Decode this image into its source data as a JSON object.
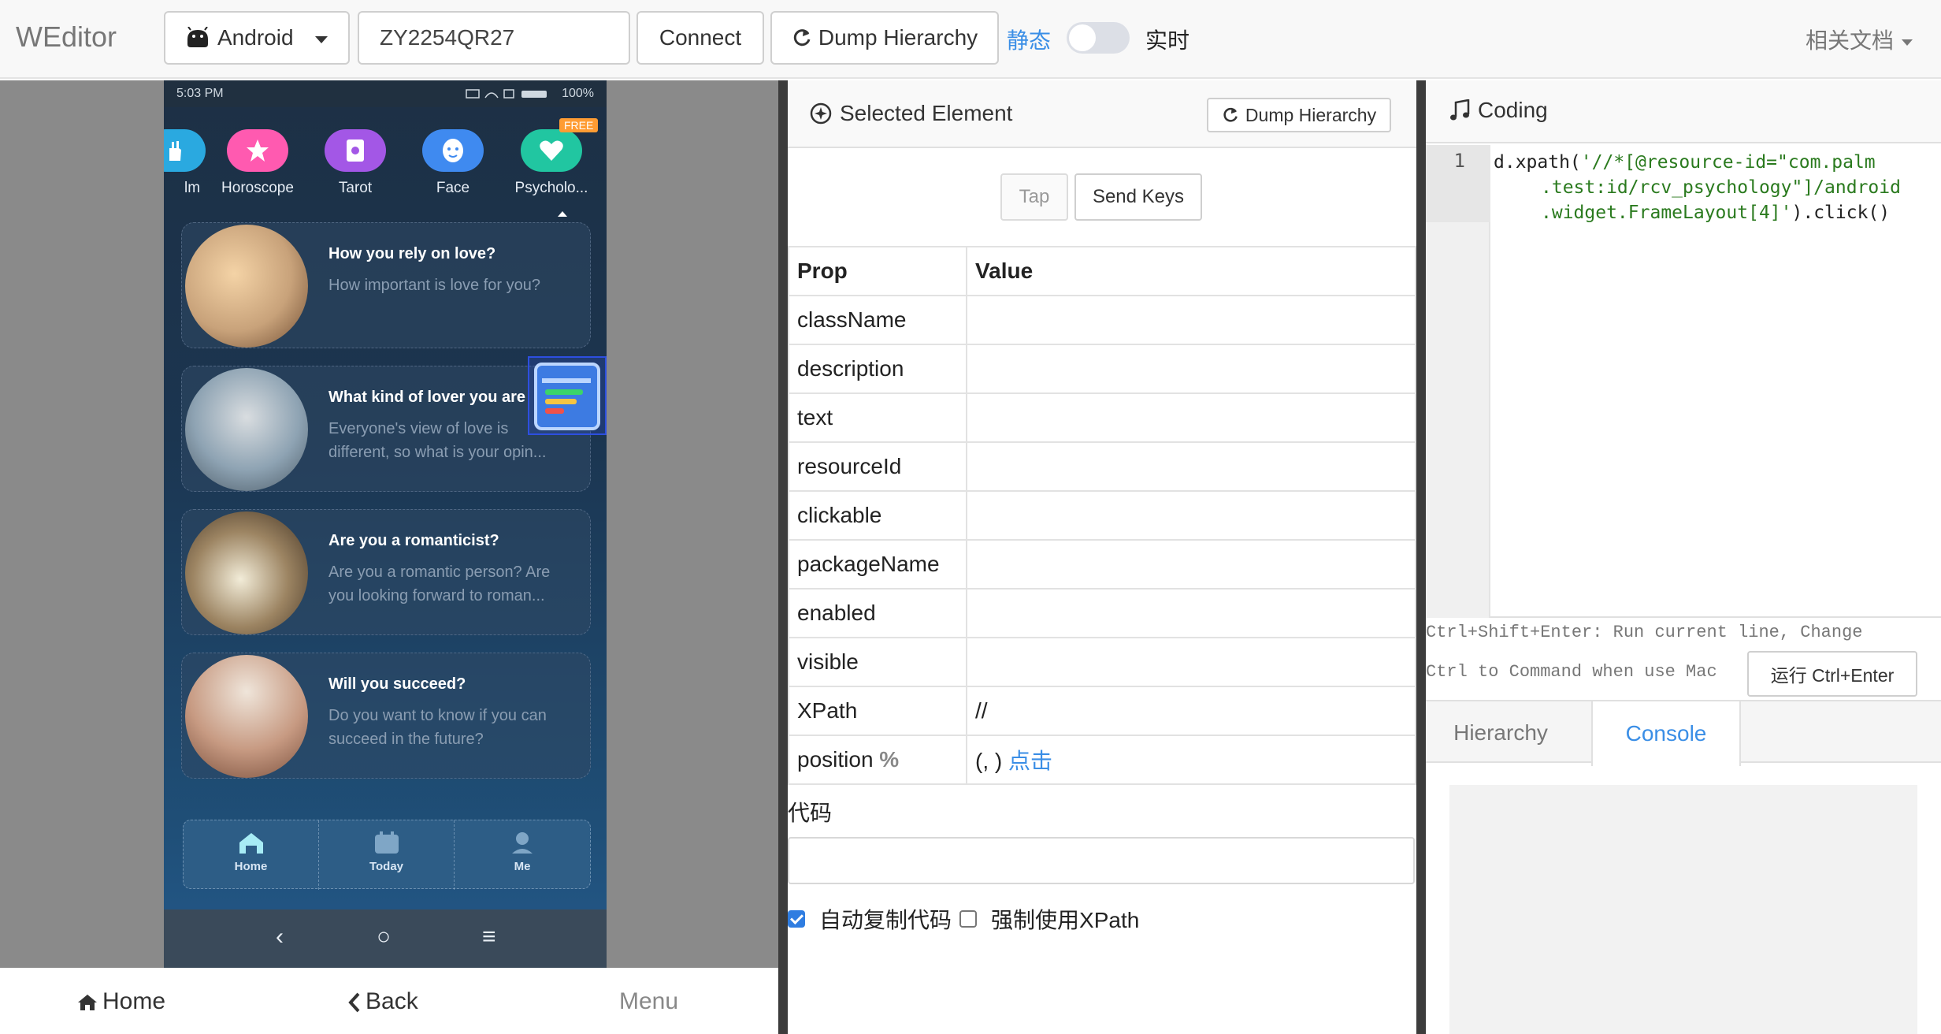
{
  "navbar": {
    "brand": "WEditor",
    "platform": "Android",
    "serial": "ZY2254QR27",
    "connect": "Connect",
    "dump": "Dump Hierarchy",
    "mode_static": "静态",
    "mode_live": "实时",
    "docs": "相关文档"
  },
  "device": {
    "status": {
      "time": "5:03 PM",
      "battery": "100%"
    },
    "categories": [
      {
        "label": "lm",
        "color": "#2aa9e0"
      },
      {
        "label": "Horoscope",
        "color": "#ff5ab0"
      },
      {
        "label": "Tarot",
        "color": "#a357e6"
      },
      {
        "label": "Face",
        "color": "#3f8af0"
      },
      {
        "label": "Psycholo...",
        "color": "#21c6a1"
      }
    ],
    "free_badge": "FREE",
    "cards": [
      {
        "title": "How you rely on love?",
        "desc": "How important is love for you?",
        "color": "#c8a27a"
      },
      {
        "title": "What kind of lover you are",
        "desc": "Everyone's view of love is different, so what is your opin...",
        "color": "#8ea3b3"
      },
      {
        "title": "Are you a romanticist?",
        "desc": "Are you a romantic person? Are you looking forward to roman...",
        "color": "#9c8462"
      },
      {
        "title": "Will you succeed?",
        "desc": "Do you want to know if you can succeed in the future?",
        "color": "#c79a82"
      }
    ],
    "tabs": [
      {
        "label": "Home"
      },
      {
        "label": "Today"
      },
      {
        "label": "Me"
      }
    ],
    "sysnav": {
      "back": "‹",
      "home": "○",
      "menu": "≡"
    }
  },
  "bottom_nav": {
    "home": "Home",
    "back": "Back",
    "menu": "Menu"
  },
  "selected": {
    "title": "Selected Element",
    "dump": "Dump Hierarchy",
    "tap": "Tap",
    "send_keys": "Send Keys",
    "col_prop": "Prop",
    "col_value": "Value",
    "props": {
      "className": "className",
      "description": "description",
      "text": "text",
      "resourceId": "resourceId",
      "clickable": "clickable",
      "packageName": "packageName",
      "enabled": "enabled",
      "visible": "visible",
      "xpath": "XPath",
      "xpath_value": "//",
      "position": "position",
      "position_unit": "%",
      "position_value": "(, )",
      "position_click": "点击"
    },
    "code_label": "代码",
    "auto_copy": "自动复制代码",
    "force_xpath": "强制使用XPath"
  },
  "coding": {
    "title": "Coding",
    "line_no": "1",
    "code_prefix": "d.xpath(",
    "code_string_1": "'//*[@resource-id=\"com.palm",
    "code_string_2": ".test:id/rcv_psychology\"]/android",
    "code_string_3": ".widget.FrameLayout[4]'",
    "code_suffix": ").click()",
    "hint_line1": "Ctrl+Shift+Enter: Run current line, Change",
    "hint_line2": "Ctrl to Command when use Mac",
    "run": "运行 Ctrl+Enter",
    "tab_hierarchy": "Hierarchy",
    "tab_console": "Console"
  }
}
